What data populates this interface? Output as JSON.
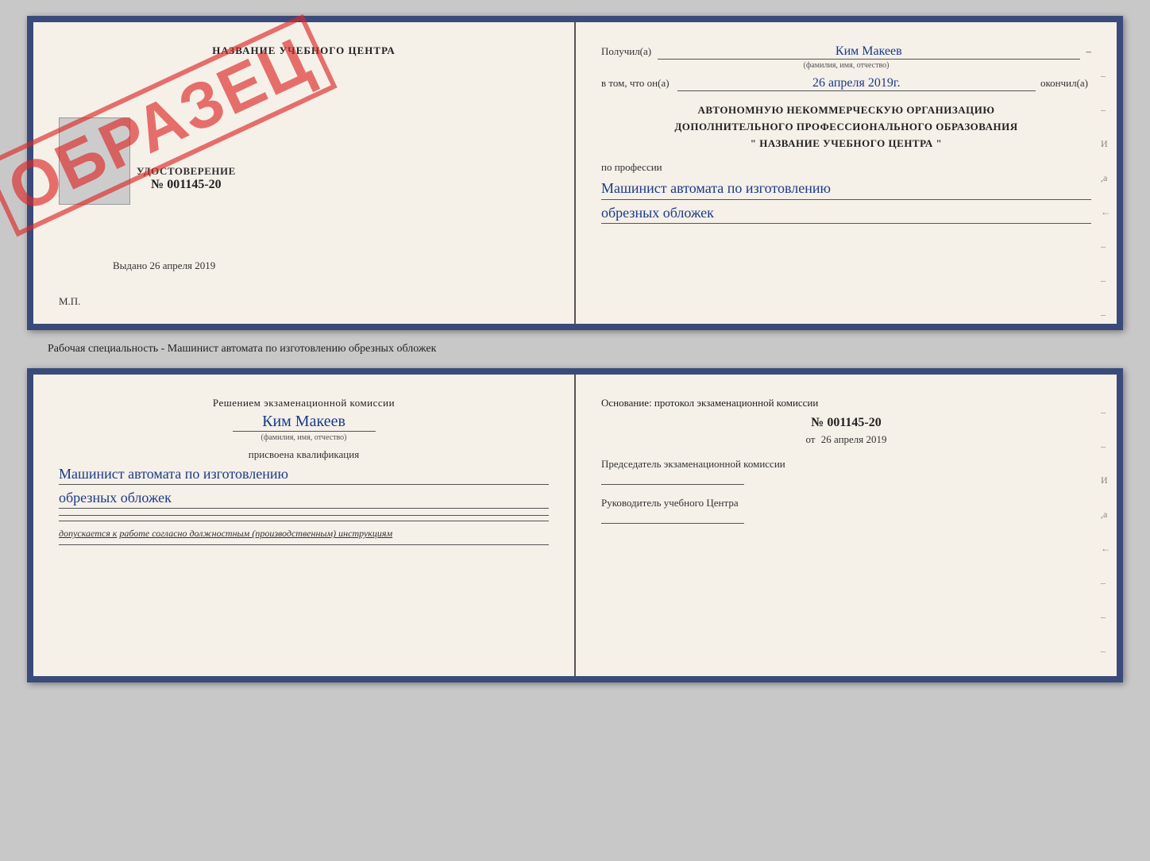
{
  "doc1": {
    "left": {
      "title": "НАЗВАНИЕ УЧЕБНОГО ЦЕНТРА",
      "stamp_text": "ОБРАЗЕЦ",
      "udostoverenie_label": "УДОСТОВЕРЕНИЕ",
      "number": "№ 001145-20",
      "vydano": "Выдано 26 апреля 2019",
      "mp": "М.П."
    },
    "right": {
      "poluchil_label": "Получил(а)",
      "poluchil_name": "Ким Макеев",
      "fio_subtitle": "(фамилия, имя, отчество)",
      "v_tom_label": "в том, что он(а)",
      "date_value": "26 апреля 2019г.",
      "okonchil_label": "окончил(а)",
      "org_line1": "АВТОНОМНУЮ НЕКОММЕРЧЕСКУЮ ОРГАНИЗАЦИЮ",
      "org_line2": "ДОПОЛНИТЕЛЬНОГО ПРОФЕССИОНАЛЬНОГО ОБРАЗОВАНИЯ",
      "org_line3": "\"  НАЗВАНИЕ УЧЕБНОГО ЦЕНТРА  \"",
      "po_professii": "по профессии",
      "profession_line1": "Машинист автомата по изготовлению",
      "profession_line2": "обрезных обложек"
    }
  },
  "caption": "Рабочая специальность - Машинист автомата по изготовлению обрезных обложек",
  "doc2": {
    "left": {
      "resheniem_label": "Решением экзаменационной комиссии",
      "name_value": "Ким Макеев",
      "fio_subtitle": "(фамилия, имя, отчество)",
      "prisvoena_label": "присвоена квалификация",
      "qual_line1": "Машинист автомата по изготовлению",
      "qual_line2": "обрезных обложек",
      "dopuskaetsya_label": "допускается к",
      "dopuskaetsya_value": "работе согласно должностным (производственным) инструкциям"
    },
    "right": {
      "osnovanie_label": "Основание: протокол экзаменационной комиссии",
      "protocol_number": "№ 001145-20",
      "ot_label": "от",
      "protocol_date": "26 апреля 2019",
      "predsedatel_label": "Председатель экзаменационной комиссии",
      "rukovoditel_label": "Руководитель учебного Центра"
    }
  },
  "side_dashes": [
    "-",
    "-",
    "-",
    "И",
    ",а",
    "←",
    "-",
    "-",
    "-",
    "-"
  ]
}
